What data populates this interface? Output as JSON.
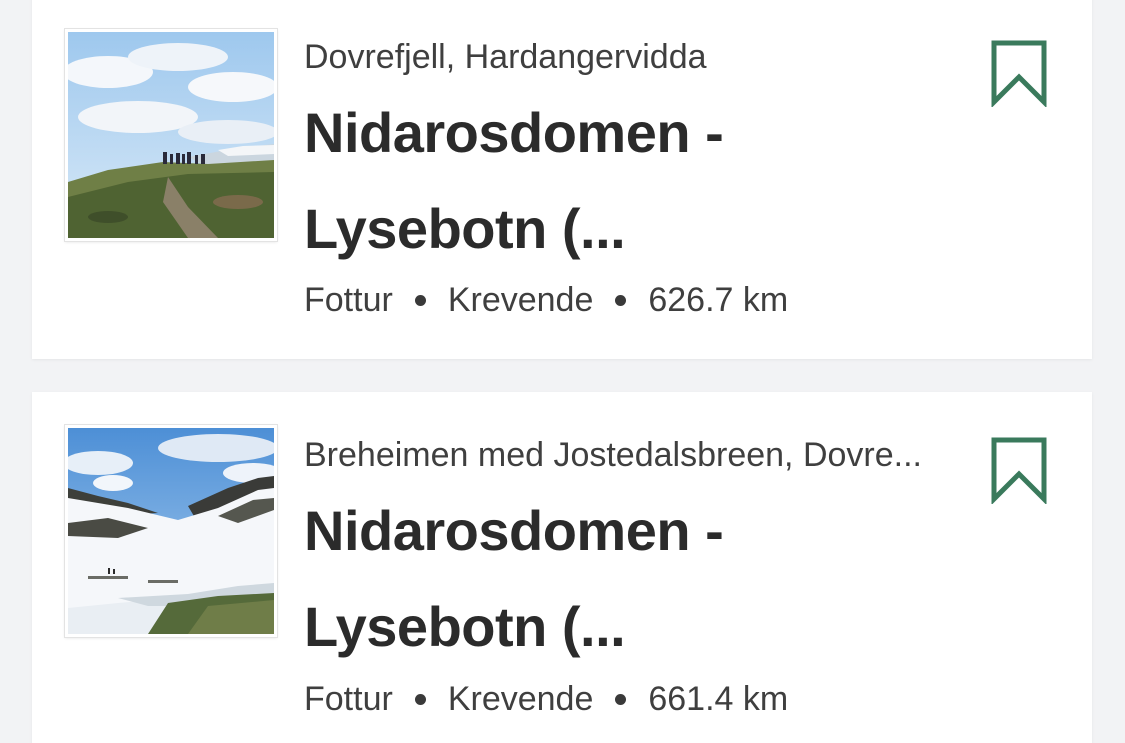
{
  "colors": {
    "background": "#f2f3f5",
    "card": "#ffffff",
    "bookmark": "#3a7a5c",
    "title_text": "#2b2b2b",
    "body_text": "#3f3f3f"
  },
  "trips": [
    {
      "region": "Dovrefjell, Hardangervidda",
      "title_line1": "Nidarosdomen -",
      "title_line2": "Lysebotn (...",
      "activity": "Fottur",
      "difficulty": "Krevende",
      "distance": "626.7 km",
      "image_icon": "grassy-hill-photo",
      "bookmark_icon": "bookmark-outline-icon"
    },
    {
      "region": "Breheimen med Jostedalsbreen, Dovre...",
      "title_line1": "Nidarosdomen -",
      "title_line2": "Lysebotn (...",
      "activity": "Fottur",
      "difficulty": "Krevende",
      "distance": "661.4 km",
      "image_icon": "snowy-mountain-photo",
      "bookmark_icon": "bookmark-outline-icon"
    }
  ]
}
